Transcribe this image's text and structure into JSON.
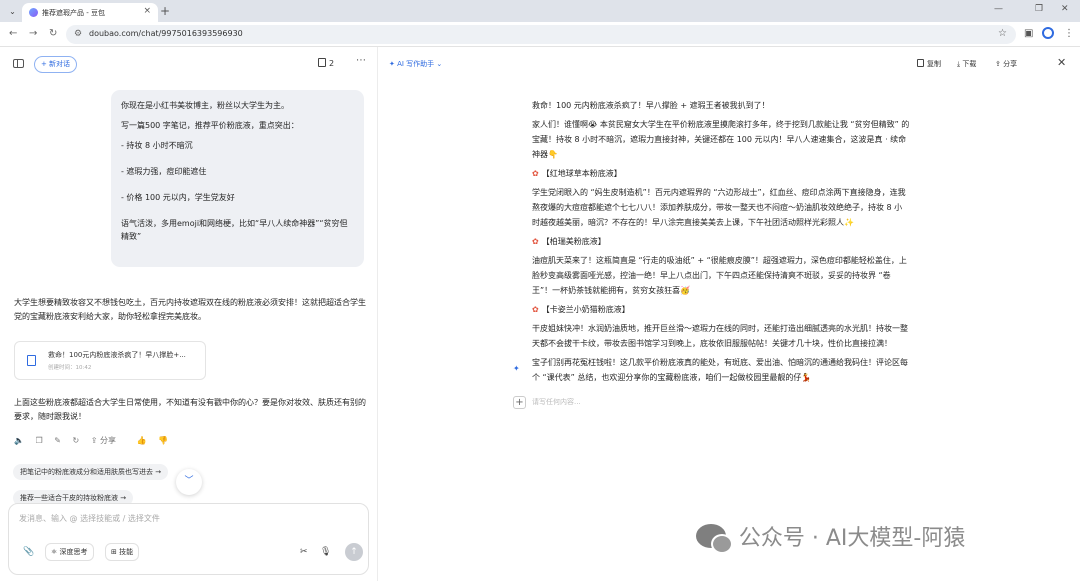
{
  "browser": {
    "tab_title": "推荐遮瑕产品 - 豆包",
    "url": "doubao.com/chat/9975016393596930",
    "new_tab_icon": "plus-icon",
    "window_controls": [
      "⌄",
      "—",
      "❐",
      "✕"
    ]
  },
  "left": {
    "new_chat_label": "+ 新对话",
    "doc_count": "2",
    "user_message": [
      "你现在是小红书美妆博主，粉丝以大学生为主。",
      "写一篇500 字笔记，推荐平价粉底液，重点突出：",
      "- 持妆 8 小时不暗沉",
      "- 遮瑕力强，痘印能遮住",
      "- 价格 100 元以内，学生党友好",
      "语气活泼，多用emoji和网络梗，比如“早八人续命神器”“贫穷但精致”"
    ],
    "reply_intro": "大学生想要精致妆容又不想钱包吃土，百元内持妆遮瑕双在线的粉底液必须安排！这就把超适合学生党的宝藏粉底液安利给大家，助你轻松拿捏完美底妆。",
    "doc_card": {
      "title": "救命！100元内粉底液杀疯了！早八撑脸+...",
      "time": "创建时间：10:42"
    },
    "reply_outro": "上面这些粉底液都超适合大学生日常使用，不知道有没有戳中你的心？要是你对妆效、肤质还有别的要求，随时跟我说！",
    "actions": {
      "share_label": "分享"
    },
    "suggestions": [
      "把笔记中的粉底液成分和适用肤质也写进去 →",
      "推荐一些适合干皮的持妆粉底液 →"
    ],
    "composer": {
      "placeholder": "发消息、输入 @ 选择技能或 / 选择文件",
      "deep_think_label": "深度思考",
      "skills_label": "技能"
    }
  },
  "right": {
    "writer_label": "AI 写作助手",
    "copy_label": "复制",
    "download_label": "下载",
    "share_label": "分享",
    "doc_title": "救命！100 元内粉底液杀疯了！早八撑脸 + 遮瑕王者被我扒到了！",
    "doc_intro": "家人们！谁懂啊😭 本贫民窟女大学生在平价粉底液里摸爬滚打多年，终于挖到几款能让我 “贫穷但精致” 的宝藏！持妆 8 小时不暗沉，遮瑕力直接封神，关键还都在 100 元以内！早八人速速集合，这波是真 · 续命神器👇",
    "items": [
      {
        "heading": "【红地球草本粉底液】",
        "body": "学生党闭眼入的 “妈生皮制造机”！百元内遮瑕界的 “六边形战士”，红血丝、痘印点涂两下直接隐身，连我熬夜爆的大痘痘都能遮个七七八八！添加养肤成分，带妆一整天也不闷痘～奶油肌妆效绝绝子，持妆 8 小时越夜越美丽，暗沉？不存在的！早八涂完直接美美去上课，下午社团活动照样光彩照人✨"
      },
      {
        "heading": "【柏瑞美粉底液】",
        "body": "油痘肌天菜来了！这瓶简直是 “行走的吸油纸” + “很能痕皮膜”！超强遮瑕力，深色痘印都能轻松盖住，上脸秒变高级雾面哑光感，控油一绝！早上八点出门，下午四点还能保持清爽不斑驳，妥妥的持妆界 “卷王”！一杯奶茶钱就能拥有，贫穷女孩狂喜🥳"
      },
      {
        "heading": "【卡姿兰小奶猫粉底液】",
        "body": "干皮姐妹快冲！水润奶油质地，推开巨丝滑～遮瑕力在线的同时，还能打造出细腻透亮的水光肌！持妆一整天都不会拔干卡纹，带妆去图书馆学习到晚上，底妆依旧服服帖帖！关键才几十块，性价比直接拉满！"
      }
    ],
    "doc_outro": "宝子们别再花冤枉钱啦！这几款平价粉底液真的能处，有斑底、爱出油、怕暗沉的通通给我码住！评论区每个 “课代表” 总结，也欢迎分享你的宝藏粉底液，咱们一起做校园里最靓的仔💃",
    "placeholder": "请写任何内容..."
  },
  "watermark": "公众号 · AI大模型-阿猿",
  "accent_color": "#2f6be0"
}
